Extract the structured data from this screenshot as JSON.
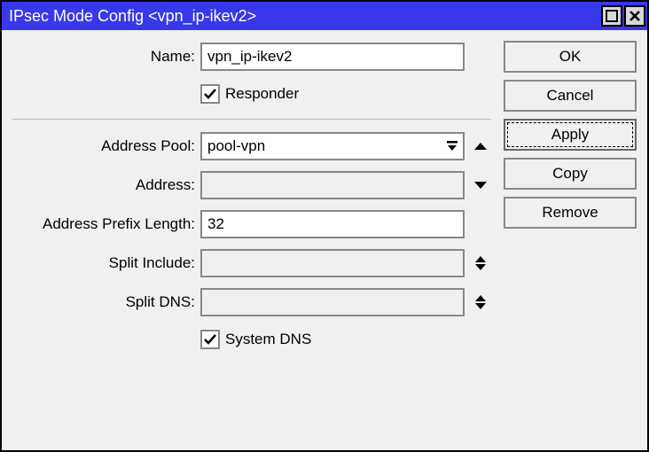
{
  "window": {
    "title": "IPsec Mode Config <vpn_ip-ikev2>"
  },
  "form": {
    "name_label": "Name:",
    "name_value": "vpn_ip-ikev2",
    "responder_label": "Responder",
    "responder_checked": true,
    "address_pool_label": "Address Pool:",
    "address_pool_value": "pool-vpn",
    "address_label": "Address:",
    "address_value": "",
    "prefix_label": "Address Prefix Length:",
    "prefix_value": "32",
    "split_include_label": "Split Include:",
    "split_include_value": "",
    "split_dns_label": "Split DNS:",
    "split_dns_value": "",
    "system_dns_label": "System DNS",
    "system_dns_checked": true
  },
  "buttons": {
    "ok": "OK",
    "cancel": "Cancel",
    "apply": "Apply",
    "copy": "Copy",
    "remove": "Remove"
  }
}
